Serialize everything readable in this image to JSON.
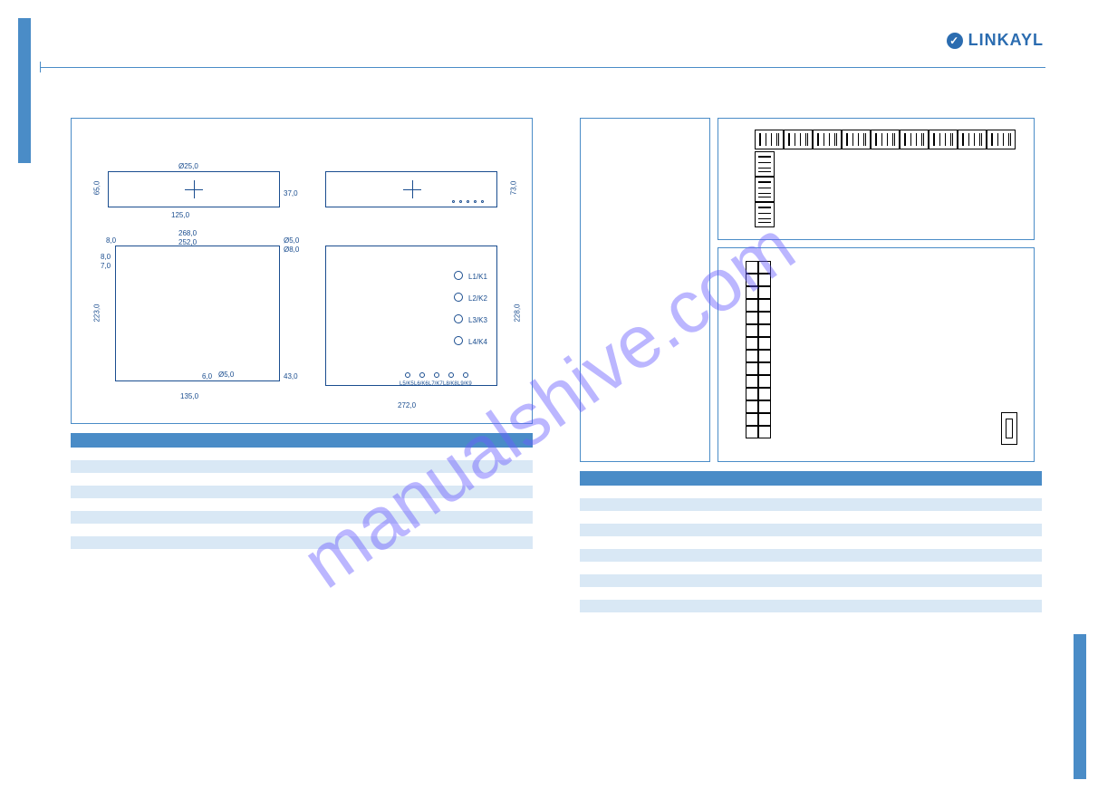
{
  "brand": "LINKAYL",
  "watermark": "manualshive.com",
  "left_diagram": {
    "dims": {
      "phi25": "Ø25,0",
      "h65": "65,0",
      "v37": "37,0",
      "w125": "125,0",
      "h73": "73,0",
      "w268": "268,0",
      "v8": "8,0",
      "w252": "252,0",
      "phi5a": "Ø5,0",
      "phi8": "Ø8,0",
      "v8b": "8,0",
      "v7": "7,0",
      "h223": "223,0",
      "h228": "228,0",
      "v6": "6,0",
      "phi5b": "Ø5,0",
      "v43": "43,0",
      "w135": "135,0",
      "w272": "272,0"
    },
    "labels": {
      "l1": "L1/K1",
      "l2": "L2/K2",
      "l3": "L3/K3",
      "l4": "L4/K4",
      "t1": "L5/K5",
      "t2": "L6/K6",
      "t3": "L7/K7",
      "t4": "L8/K8",
      "t5": "L9/K9"
    }
  },
  "left_table": {
    "headers": [
      "",
      "",
      "",
      ""
    ],
    "rows": [
      [
        "",
        "",
        "",
        ""
      ],
      [
        "",
        "",
        "",
        ""
      ],
      [
        "",
        "",
        "",
        ""
      ],
      [
        "",
        "",
        "",
        ""
      ],
      [
        "",
        "",
        "",
        ""
      ],
      [
        "",
        "",
        "",
        ""
      ],
      [
        "",
        "",
        "",
        ""
      ],
      [
        "",
        "",
        "",
        ""
      ],
      [
        "",
        "",
        "",
        ""
      ]
    ]
  },
  "right_table": {
    "headers": [
      "",
      "",
      "",
      "",
      ""
    ],
    "rows": [
      [
        "",
        "",
        "",
        "",
        ""
      ],
      [
        "",
        "",
        "",
        "",
        ""
      ],
      [
        "",
        "",
        "",
        "",
        ""
      ],
      [
        "",
        "",
        "",
        "",
        ""
      ],
      [
        "",
        "",
        "",
        "",
        ""
      ],
      [
        "",
        "",
        "",
        "",
        ""
      ],
      [
        "",
        "",
        "",
        "",
        ""
      ],
      [
        "",
        "",
        "",
        "",
        ""
      ],
      [
        "",
        "",
        "",
        "",
        ""
      ],
      [
        "",
        "",
        "",
        "",
        ""
      ],
      [
        "",
        "",
        "",
        "",
        ""
      ]
    ]
  }
}
